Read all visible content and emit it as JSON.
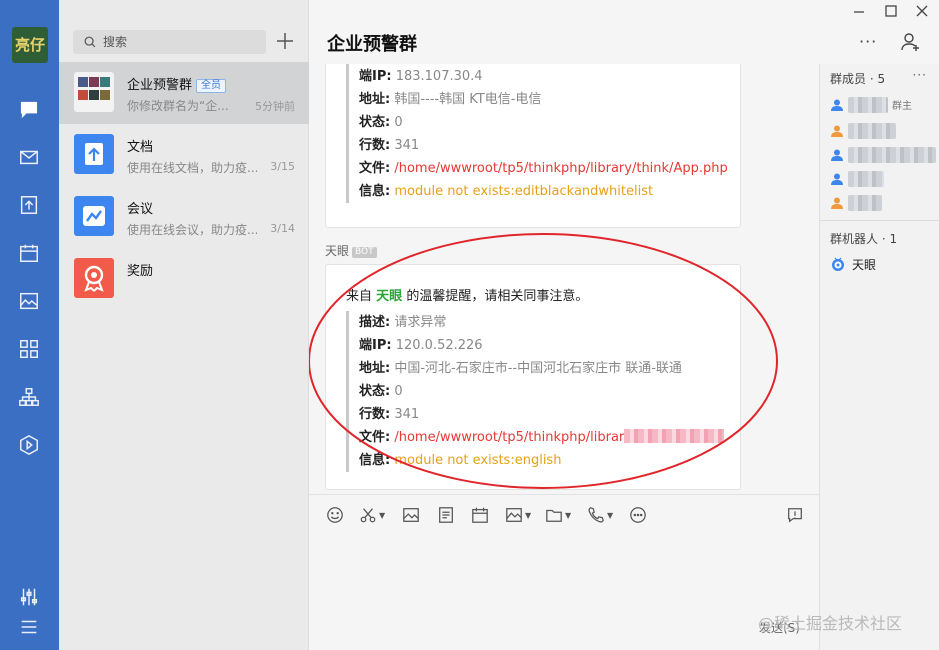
{
  "app": {
    "logo_text": "亮仔",
    "nav_icons": [
      "chat-icon",
      "mail-icon",
      "docs-icon",
      "calendar-icon",
      "image-icon",
      "apps-icon",
      "org-icon",
      "video-icon",
      "settings-sliders-icon",
      "menu-icon"
    ]
  },
  "sidebar": {
    "search_placeholder": "搜索",
    "conversations": [
      {
        "name": "企业预警群",
        "badge": "全员",
        "preview": "你修改群名为“企...",
        "time": "5分钟前"
      },
      {
        "name": "文档",
        "preview": "使用在线文档，助力疫...",
        "time": "3/15"
      },
      {
        "name": "会议",
        "preview": "使用在线会议，助力疫...",
        "time": "3/14"
      },
      {
        "name": "奖励",
        "preview": "",
        "time": ""
      }
    ]
  },
  "chat": {
    "title": "企业预警群",
    "more": "···",
    "message1": {
      "rows": [
        {
          "k": "端IP:",
          "v": "183.107.30.4"
        },
        {
          "k": "地址:",
          "v": "韩国----韩国 KT电信-电信"
        },
        {
          "k": "状态:",
          "v": "0"
        },
        {
          "k": "行数:",
          "v": "341"
        },
        {
          "k": "文件:",
          "v": "/home/wwwroot/tp5/thinkphp/library/think/App.php"
        },
        {
          "k": "信息:",
          "v": "module not exists:editblackandwhitelist"
        }
      ]
    },
    "sender": "天眼",
    "sender_tag": "BOT",
    "message2": {
      "intro_pre": "来自",
      "intro_name": "天眼",
      "intro_post": "的温馨提醒，请相关同事注意。",
      "rows": [
        {
          "k": "描述:",
          "v": "请求异常"
        },
        {
          "k": "端IP:",
          "v": "120.0.52.226"
        },
        {
          "k": "地址:",
          "v": "中国-河北-石家庄市--中国河北石家庄市 联通-联通"
        },
        {
          "k": "状态:",
          "v": "0"
        },
        {
          "k": "行数:",
          "v": "341"
        },
        {
          "k": "文件:",
          "v": "/home/wwwroot/tp5/thinkphp/librar"
        },
        {
          "k": "信息:",
          "v": "module not exists:english"
        }
      ]
    },
    "send_label": "发送(S)"
  },
  "members": {
    "title": "群成员 · 5",
    "owner_role": "群主",
    "bots_title": "群机器人 · 1",
    "bot_name": "天眼"
  },
  "watermark": "@稀土掘金技术社区",
  "colors": {
    "nav": "#3a6fc4",
    "red": "#e53935",
    "orange": "#e6a117",
    "green": "#2aa537"
  }
}
